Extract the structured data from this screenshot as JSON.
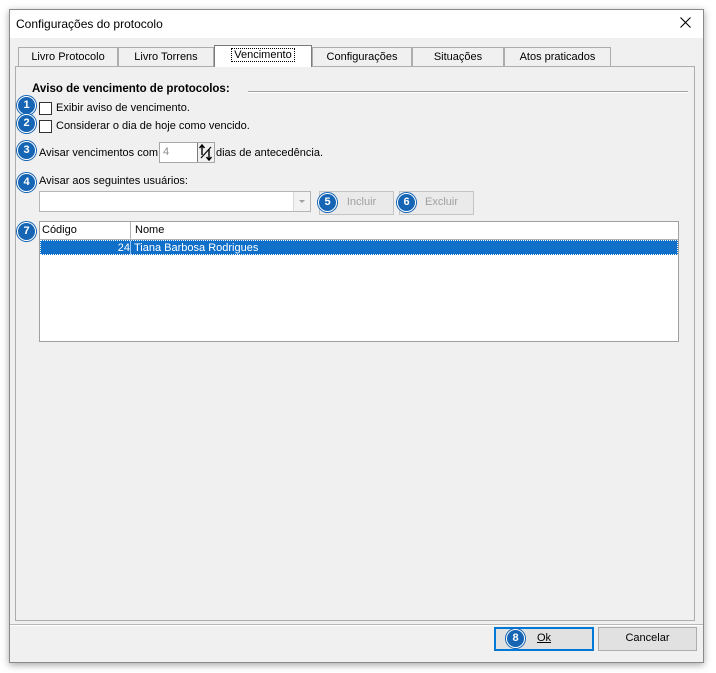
{
  "window": {
    "title": "Configurações do protocolo"
  },
  "tabs": [
    {
      "label": "Livro Protocolo"
    },
    {
      "label": "Livro Torrens"
    },
    {
      "label": "Vencimento"
    },
    {
      "label": "Configurações"
    },
    {
      "label": "Situações"
    },
    {
      "label": "Atos praticados"
    }
  ],
  "active_tab": "Vencimento",
  "section": {
    "title": "Aviso de vencimento de protocolos:"
  },
  "badges": [
    "1",
    "2",
    "3",
    "4",
    "5",
    "6",
    "7",
    "8"
  ],
  "options": {
    "exibir_aviso": {
      "label": "Exibir aviso de vencimento.",
      "checked": false
    },
    "considerar_hoje": {
      "label": "Considerar o dia de hoje como vencido.",
      "checked": false
    }
  },
  "avisar": {
    "prefix": "Avisar vencimentos com",
    "value": "4",
    "suffix": "dias de antecedência."
  },
  "usuarios": {
    "label": "Avisar aos seguintes usuários:",
    "selected": ""
  },
  "buttons": {
    "incluir": "Incluir",
    "excluir": "Excluir",
    "ok": "Ok",
    "cancelar": "Cancelar"
  },
  "grid": {
    "columns": [
      "Código",
      "Nome"
    ],
    "rows": [
      {
        "codigo": "24",
        "nome": "Tiana Barbosa Rodrigues",
        "selected": true
      }
    ]
  },
  "colors": {
    "badge": "#1565b4",
    "selection": "#0f6fc9"
  }
}
